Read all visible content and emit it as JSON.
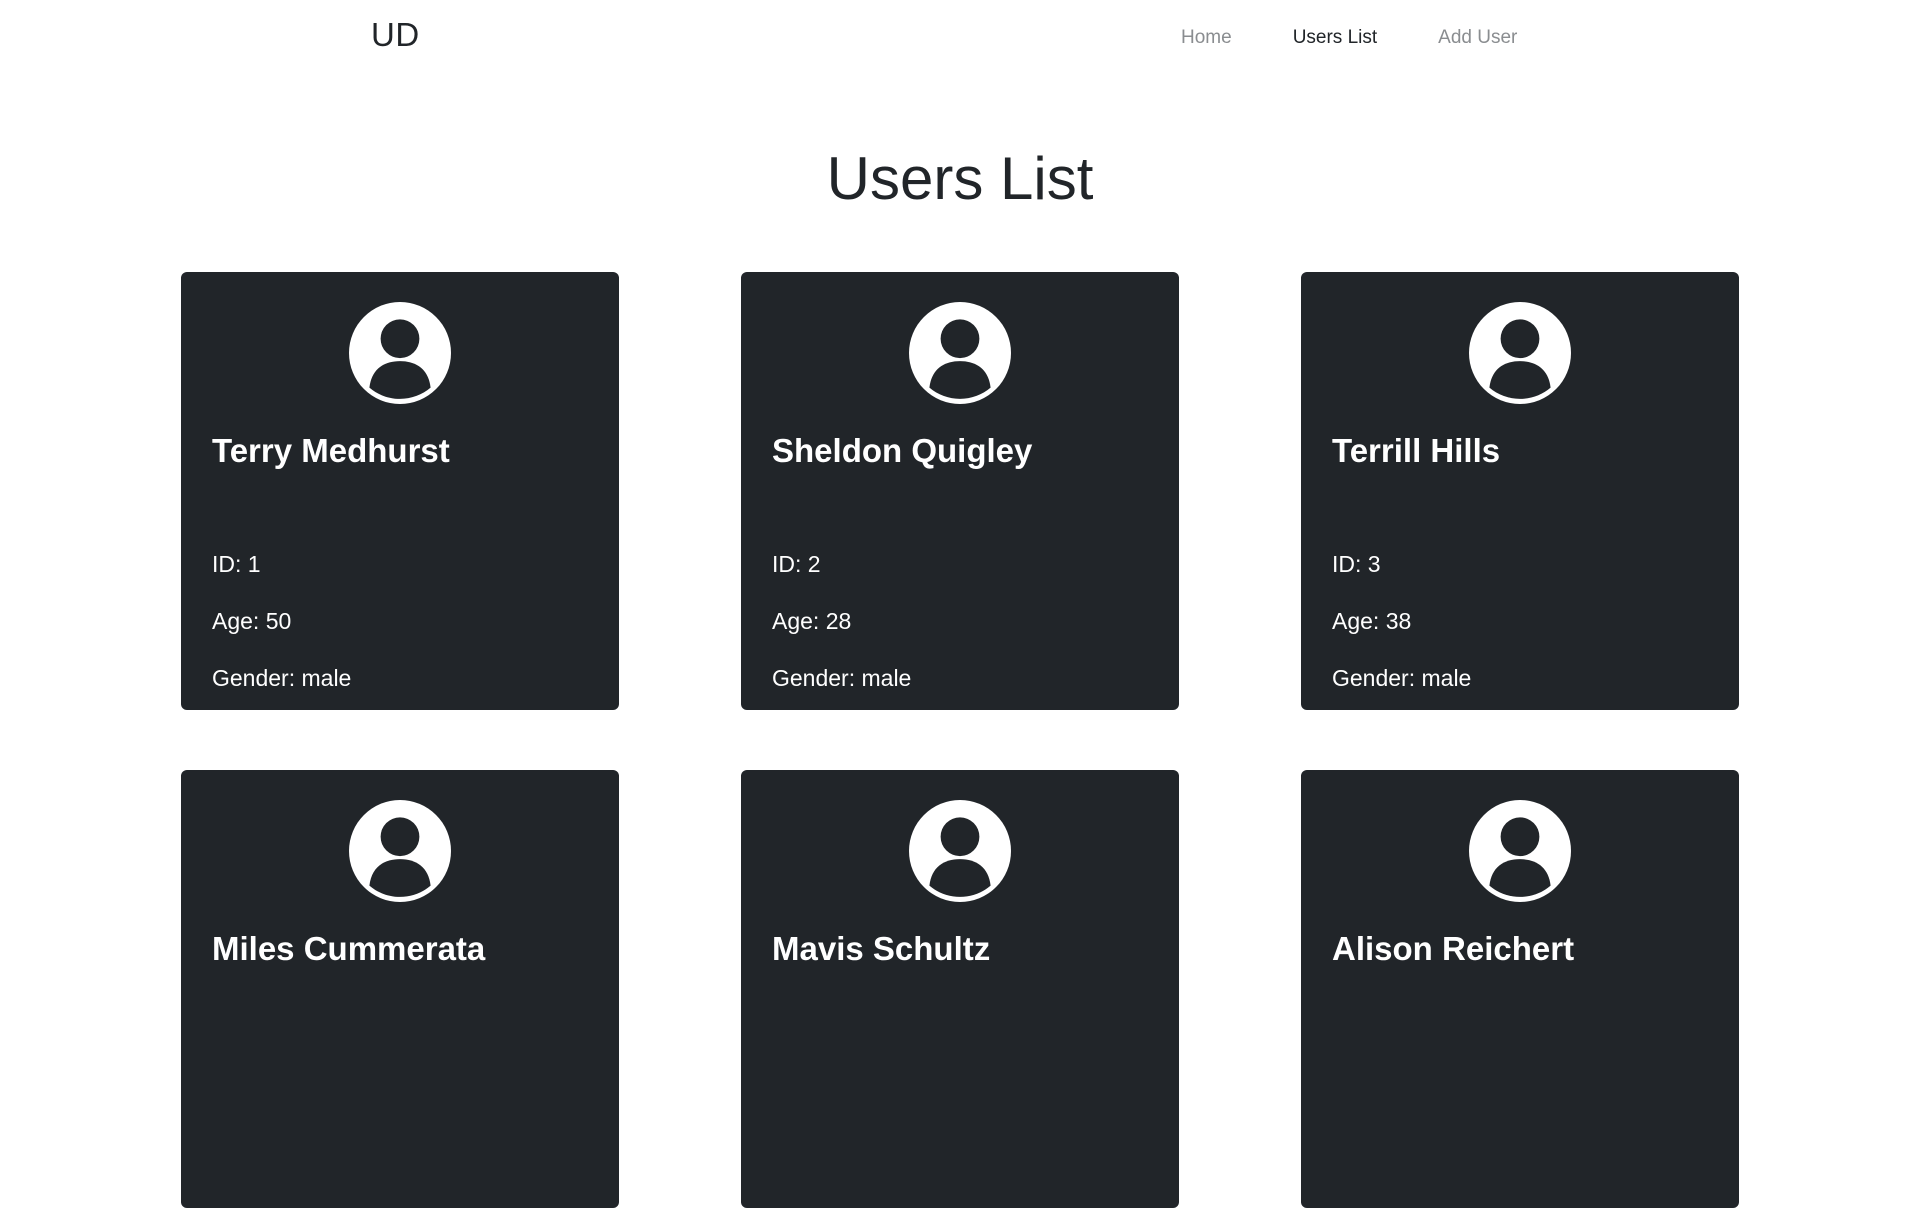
{
  "navbar": {
    "brand": "UD",
    "links": [
      {
        "label": "Home",
        "active": false
      },
      {
        "label": "Users List",
        "active": true
      },
      {
        "label": "Add User",
        "active": false
      }
    ]
  },
  "page": {
    "title": "Users List"
  },
  "users": [
    {
      "name": "Terry Medhurst",
      "id_text": "ID: 1",
      "age_text": "Age: 50",
      "gender_text": "Gender: male"
    },
    {
      "name": "Sheldon Quigley",
      "id_text": "ID: 2",
      "age_text": "Age: 28",
      "gender_text": "Gender: male"
    },
    {
      "name": "Terrill Hills",
      "id_text": "ID: 3",
      "age_text": "Age: 38",
      "gender_text": "Gender: male"
    },
    {
      "name": "Miles Cummerata",
      "id_text": "",
      "age_text": "",
      "gender_text": ""
    },
    {
      "name": "Mavis Schultz",
      "id_text": "",
      "age_text": "",
      "gender_text": ""
    },
    {
      "name": "Alison Reichert",
      "id_text": "",
      "age_text": "",
      "gender_text": ""
    }
  ],
  "colors": {
    "card_bg": "#212529",
    "card_text": "#ffffff",
    "nav_inactive": "#8a8d90",
    "nav_active": "#212529"
  },
  "icons": {
    "avatar": "user-circle-icon"
  }
}
